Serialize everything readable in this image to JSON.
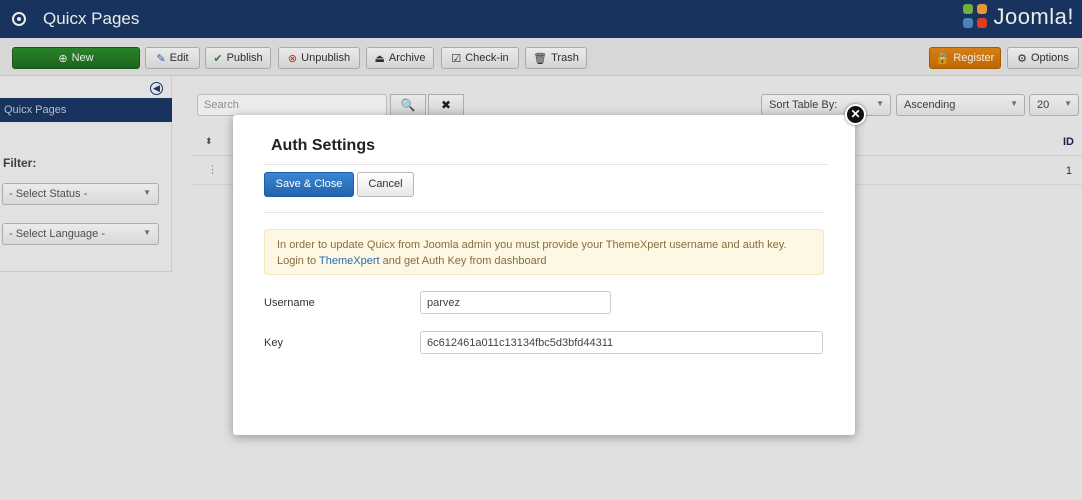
{
  "header": {
    "title": "Quicx Pages",
    "logo_text": "Joomla!",
    "brand_color": "#1a3867"
  },
  "toolbar": {
    "new_label": "New",
    "edit_label": "Edit",
    "publish_label": "Publish",
    "unpublish_label": "Unpublish",
    "archive_label": "Archive",
    "checkin_label": "Check-in",
    "trash_label": "Trash",
    "register_label": "Register",
    "options_label": "Options"
  },
  "sidebar": {
    "active_item": "Quicx Pages",
    "filter_label": "Filter:",
    "status_select": "- Select Status -",
    "language_select": "- Select Language -"
  },
  "list": {
    "search_placeholder": "Search",
    "sort_by": "Sort Table By:",
    "order": "Ascending",
    "limit": "20",
    "id_header": "ID",
    "row_id": "1"
  },
  "modal": {
    "title": "Auth Settings",
    "save_label": "Save & Close",
    "cancel_label": "Cancel",
    "alert_text_1": "In order to update Quicx from Joomla admin you must provide your ThemeXpert username and auth key. Login to ",
    "alert_link": "ThemeXpert",
    "alert_text_2": " and get Auth Key from dashboard",
    "username_label": "Username",
    "username_value": "parvez",
    "key_label": "Key",
    "key_value": "6c612461a011c13134fbc5d3bfd44311"
  },
  "icons": {
    "new": "plus-circle-icon",
    "edit": "edit-icon",
    "publish": "check-icon",
    "unpublish": "x-circle-icon",
    "archive": "archive-icon",
    "checkin": "checkbox-icon",
    "trash": "trash-icon",
    "register": "lock-icon",
    "options": "gear-icon",
    "search": "search-icon",
    "clear": "times-icon",
    "close": "close-circle-icon"
  }
}
